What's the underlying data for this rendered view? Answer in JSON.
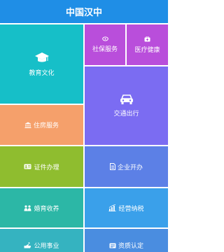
{
  "header": {
    "title": "中国汉中",
    "color": "#1f8ee6"
  },
  "tiles": [
    {
      "label": "社保服务",
      "icon": "social-security-icon",
      "color": "#b94edb"
    },
    {
      "label": "医疗健康",
      "icon": "medical-icon",
      "color": "#b94edb"
    },
    {
      "label": "教育文化",
      "icon": "graduation-cap-icon",
      "color": "#16bfc8"
    },
    {
      "label": "交通出行",
      "icon": "car-icon",
      "color": "#7b6cf2"
    },
    {
      "label": "住房服务",
      "icon": "building-icon",
      "color": "#f5a06b"
    },
    {
      "label": "证件办理",
      "icon": "id-card-icon",
      "color": "#8fbd2f"
    },
    {
      "label": "企业开办",
      "icon": "document-icon",
      "color": "#5c80e6"
    },
    {
      "label": "婚育收养",
      "icon": "family-icon",
      "color": "#2cb7a6"
    },
    {
      "label": "经营纳税",
      "icon": "bar-chart-icon",
      "color": "#3aa0ea"
    },
    {
      "label": "公用事业",
      "icon": "hand-icon",
      "color": "#35b3c0"
    },
    {
      "label": "资质认定",
      "icon": "certificate-icon",
      "color": "#4a8de0"
    }
  ]
}
